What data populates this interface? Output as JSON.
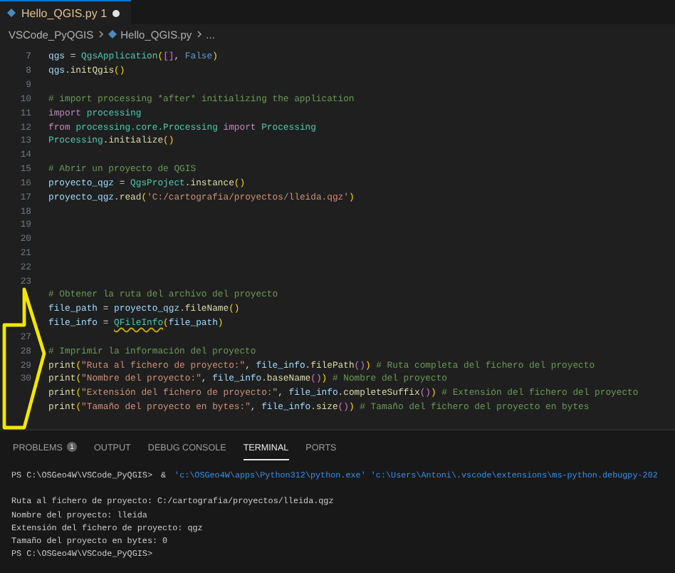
{
  "editor_tabs": [
    {
      "label": "Hello_QGIS.py",
      "problems": "1",
      "modified": true,
      "selected": true
    }
  ],
  "breadcrumb": [
    {
      "label": "VSCode_PyQGIS",
      "kind": "folder"
    },
    {
      "label": "Hello_QGIS.py",
      "kind": "file"
    },
    {
      "label": "...",
      "kind": "more"
    }
  ],
  "code_lines": [
    {
      "number": "7",
      "tokens": [
        {
          "text": "qgs",
          "kind": "var"
        },
        {
          "text": " = ",
          "kind": "plain"
        },
        {
          "text": "QgsApplication",
          "kind": "class"
        },
        {
          "text": "(",
          "kind": "bracket"
        },
        {
          "text": "[]",
          "kind": "bracket2"
        },
        {
          "text": ", ",
          "kind": "plain"
        },
        {
          "text": "False",
          "kind": "bool"
        },
        {
          "text": ")",
          "kind": "bracket"
        }
      ]
    },
    {
      "number": "8",
      "tokens": [
        {
          "text": "qgs",
          "kind": "var"
        },
        {
          "text": ".initQgis",
          "kind": "func"
        },
        {
          "text": "()",
          "kind": "bracket"
        }
      ]
    },
    {
      "number": "9"
    },
    {
      "number": "10",
      "tokens": [
        {
          "text": "# import processing *after* initializing the application",
          "kind": "comment"
        }
      ]
    },
    {
      "number": "11",
      "tokens": [
        {
          "text": "import ",
          "kind": "keyword"
        },
        {
          "text": "processing",
          "kind": "class"
        }
      ]
    },
    {
      "number": "12",
      "tokens": [
        {
          "text": "from ",
          "kind": "keyword"
        },
        {
          "text": "processing.core.Processing ",
          "kind": "class"
        },
        {
          "text": "import ",
          "kind": "keyword"
        },
        {
          "text": "Processing",
          "kind": "class"
        }
      ]
    },
    {
      "number": "13",
      "tokens": [
        {
          "text": "Processing",
          "kind": "class"
        },
        {
          "text": ".initialize",
          "kind": "func"
        },
        {
          "text": "()",
          "kind": "bracket"
        }
      ]
    },
    {
      "number": "14"
    },
    {
      "number": "15",
      "tokens": [
        {
          "text": "# Abrir un proyecto de QGIS",
          "kind": "comment"
        }
      ]
    },
    {
      "number": "16",
      "tokens": [
        {
          "text": "proyecto_qgz",
          "kind": "var"
        },
        {
          "text": " = ",
          "kind": "plain"
        },
        {
          "text": "QgsProject",
          "kind": "class"
        },
        {
          "text": ".instance",
          "kind": "func"
        },
        {
          "text": "()",
          "kind": "bracket"
        }
      ]
    },
    {
      "number": "17",
      "tokens": [
        {
          "text": "proyecto_qgz",
          "kind": "var"
        },
        {
          "text": ".read",
          "kind": "func"
        },
        {
          "text": "(",
          "kind": "bracket"
        },
        {
          "text": "'C:/cartografia/proyectos/lleida.qgz'",
          "kind": "string"
        },
        {
          "text": ")",
          "kind": "bracket"
        }
      ]
    },
    {
      "number": "18"
    },
    {
      "number": "19"
    },
    {
      "number": "20"
    },
    {
      "number": "21"
    },
    {
      "number": "22"
    },
    {
      "number": "23"
    },
    {
      "tokens": [
        {
          "text": "# Obtener la ruta del archivo del proyecto",
          "kind": "comment"
        }
      ]
    },
    {
      "tokens": [
        {
          "text": "file_path",
          "kind": "var"
        },
        {
          "text": " = ",
          "kind": "plain"
        },
        {
          "text": "proyecto_qgz",
          "kind": "var"
        },
        {
          "text": ".fileName",
          "kind": "func"
        },
        {
          "text": "()",
          "kind": "bracket"
        }
      ]
    },
    {
      "tokens": [
        {
          "text": "file_info",
          "kind": "var"
        },
        {
          "text": " = ",
          "kind": "plain"
        },
        {
          "text": "QFileInfo",
          "kind": "class",
          "warning": true
        },
        {
          "text": "(",
          "kind": "bracket"
        },
        {
          "text": "file_path",
          "kind": "var"
        },
        {
          "text": ")",
          "kind": "bracket"
        }
      ]
    },
    {
      "number": "27"
    },
    {
      "number": "28",
      "tokens": [
        {
          "text": "# Imprimir la información del proyecto",
          "kind": "comment"
        }
      ]
    },
    {
      "number": "29",
      "tokens": [
        {
          "text": "print",
          "kind": "func"
        },
        {
          "text": "(",
          "kind": "bracket"
        },
        {
          "text": "\"Ruta al fichero de proyecto:\"",
          "kind": "string"
        },
        {
          "text": ", ",
          "kind": "plain"
        },
        {
          "text": "file_info",
          "kind": "var"
        },
        {
          "text": ".filePath",
          "kind": "func"
        },
        {
          "text": "()",
          "kind": "bracket2"
        },
        {
          "text": ") ",
          "kind": "bracket"
        },
        {
          "text": "# Ruta completa del fichero del proyecto",
          "kind": "comment"
        }
      ]
    },
    {
      "number": "30",
      "tokens": [
        {
          "text": "print",
          "kind": "func"
        },
        {
          "text": "(",
          "kind": "bracket"
        },
        {
          "text": "\"Nombre del proyecto:\"",
          "kind": "string"
        },
        {
          "text": ", ",
          "kind": "plain"
        },
        {
          "text": "file_info",
          "kind": "var"
        },
        {
          "text": ".baseName",
          "kind": "func"
        },
        {
          "text": "()",
          "kind": "bracket2"
        },
        {
          "text": ") ",
          "kind": "bracket"
        },
        {
          "text": "# Nombre del proyecto",
          "kind": "comment"
        }
      ]
    },
    {
      "tokens": [
        {
          "text": "print",
          "kind": "func"
        },
        {
          "text": "(",
          "kind": "bracket"
        },
        {
          "text": "\"Extensión del fichero de proyecto:\"",
          "kind": "string"
        },
        {
          "text": ", ",
          "kind": "plain"
        },
        {
          "text": "file_info",
          "kind": "var"
        },
        {
          "text": ".completeSuffix",
          "kind": "func"
        },
        {
          "text": "()",
          "kind": "bracket2"
        },
        {
          "text": ") ",
          "kind": "bracket"
        },
        {
          "text": "# Extensión del fichero del proyecto",
          "kind": "comment"
        }
      ]
    },
    {
      "tokens": [
        {
          "text": "print",
          "kind": "func"
        },
        {
          "text": "(",
          "kind": "bracket"
        },
        {
          "text": "\"Tamaño del proyecto en bytes:\"",
          "kind": "string"
        },
        {
          "text": ", ",
          "kind": "plain"
        },
        {
          "text": "file_info",
          "kind": "var"
        },
        {
          "text": ".size",
          "kind": "func"
        },
        {
          "text": "()",
          "kind": "bracket2"
        },
        {
          "text": ") ",
          "kind": "bracket"
        },
        {
          "text": "# Tamaño del fichero del proyecto en bytes",
          "kind": "comment"
        }
      ]
    }
  ],
  "panel_tabs": [
    {
      "label": "PROBLEMS",
      "badge": "1",
      "selected": false
    },
    {
      "label": "OUTPUT",
      "selected": false
    },
    {
      "label": "DEBUG CONSOLE",
      "selected": false
    },
    {
      "label": "TERMINAL",
      "selected": true
    },
    {
      "label": "PORTS",
      "selected": false
    }
  ],
  "terminal_lines": [
    {
      "kind": "command",
      "prompt": "PS C:\\OSGeo4W\\VSCode_PyQGIS>",
      "command": "&",
      "args": "'c:\\OSGeo4W\\apps\\Python312\\python.exe' 'c:\\Users\\Antoni\\.vscode\\extensions\\ms-python.debugpy-202"
    },
    {
      "kind": "blank"
    },
    {
      "kind": "output",
      "text": "Ruta al fichero de proyecto: C:/cartografia/proyectos/lleida.qgz"
    },
    {
      "kind": "output",
      "text": "Nombre del proyecto: lleida"
    },
    {
      "kind": "output",
      "text": "Extensión del fichero de proyecto: qgz"
    },
    {
      "kind": "output",
      "text": "Tamaño del proyecto en bytes: 0"
    },
    {
      "kind": "prompt",
      "prompt": "PS C:\\OSGeo4W\\VSCode_PyQGIS>"
    }
  ]
}
